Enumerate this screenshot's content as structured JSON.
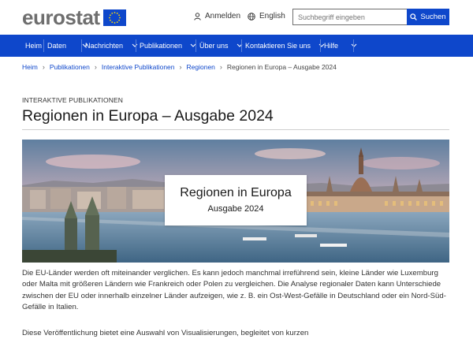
{
  "header": {
    "logo_text": "eurostat",
    "login_label": "Anmelden",
    "language_label": "English",
    "search_placeholder": "Suchbegriff eingeben",
    "search_button": "Suchen"
  },
  "nav": {
    "items": [
      "Heim",
      "Daten",
      "Nachrichten",
      "Publikationen",
      "Über uns",
      "Kontaktieren Sie uns",
      "Hilfe"
    ]
  },
  "breadcrumb": [
    "Heim",
    "Publikationen",
    "Interaktive Publikationen",
    "Regionen",
    "Regionen in Europa – Ausgabe 2024"
  ],
  "page": {
    "kicker": "INTERAKTIVE PUBLIKATIONEN",
    "title": "Regionen in Europa – Ausgabe 2024"
  },
  "hero": {
    "title": "Regionen in Europa",
    "subtitle": "Ausgabe 2024"
  },
  "body": {
    "paragraph1": "Die EU-Länder werden oft miteinander verglichen. Es kann jedoch manchmal irreführend sein, kleine Länder wie Luxemburg oder Malta mit größeren Ländern wie Frankreich oder Polen zu vergleichen. Die Analyse regionaler Daten kann Unterschiede zwischen der EU oder innerhalb einzelner Länder aufzeigen, wie z. B. ein Ost-West-Gefälle in Deutschland oder ein Nord-Süd-Gefälle in Italien.",
    "paragraph2": "Diese Veröffentlichung bietet eine Auswahl von Visualisierungen, begleitet von kurzen"
  },
  "colors": {
    "brand_blue": "#0e47cb",
    "logo_grey": "#6e6e6e"
  }
}
